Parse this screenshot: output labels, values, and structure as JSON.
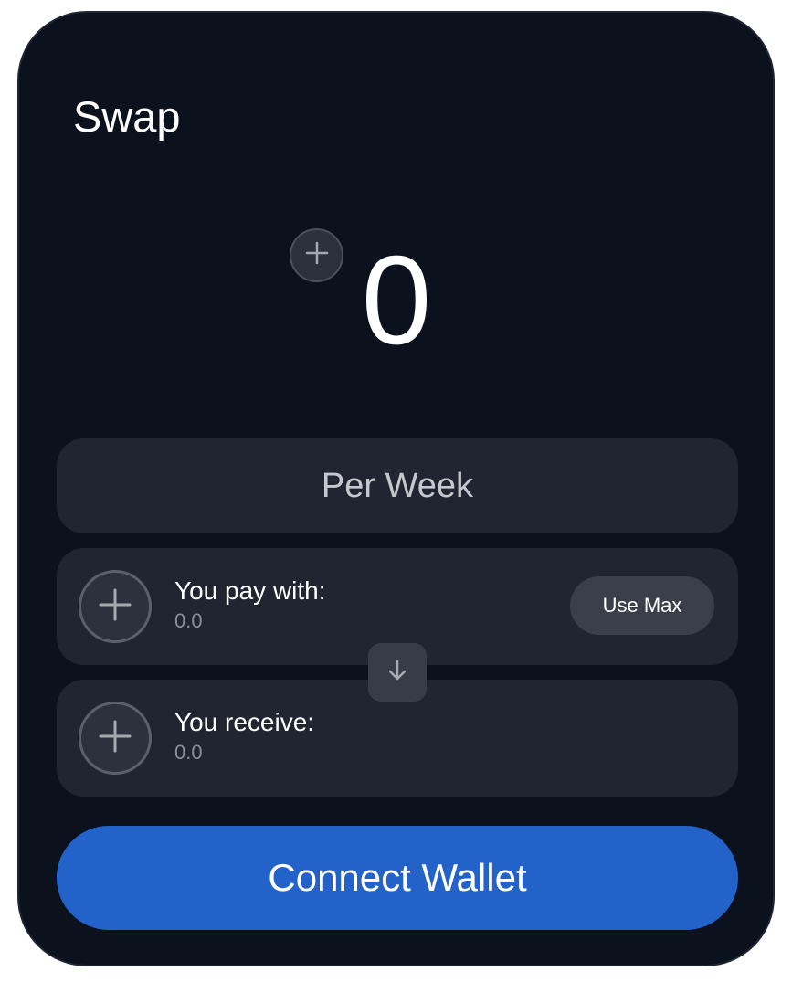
{
  "swap": {
    "title": "Swap",
    "amount": "0",
    "frequency": "Per Week",
    "pay": {
      "label": "You pay with:",
      "value": "0.0",
      "use_max_label": "Use Max"
    },
    "receive": {
      "label": "You receive:",
      "value": "0.0"
    },
    "connect_label": "Connect Wallet"
  },
  "icons": {
    "add_amount": "plus-icon",
    "add_token": "plus-icon",
    "switch": "arrow-down-icon"
  },
  "colors": {
    "card_background": "#0c111e",
    "panel_background": "#212531",
    "accent": "#2363c9",
    "muted_text": "#8b8f98"
  }
}
